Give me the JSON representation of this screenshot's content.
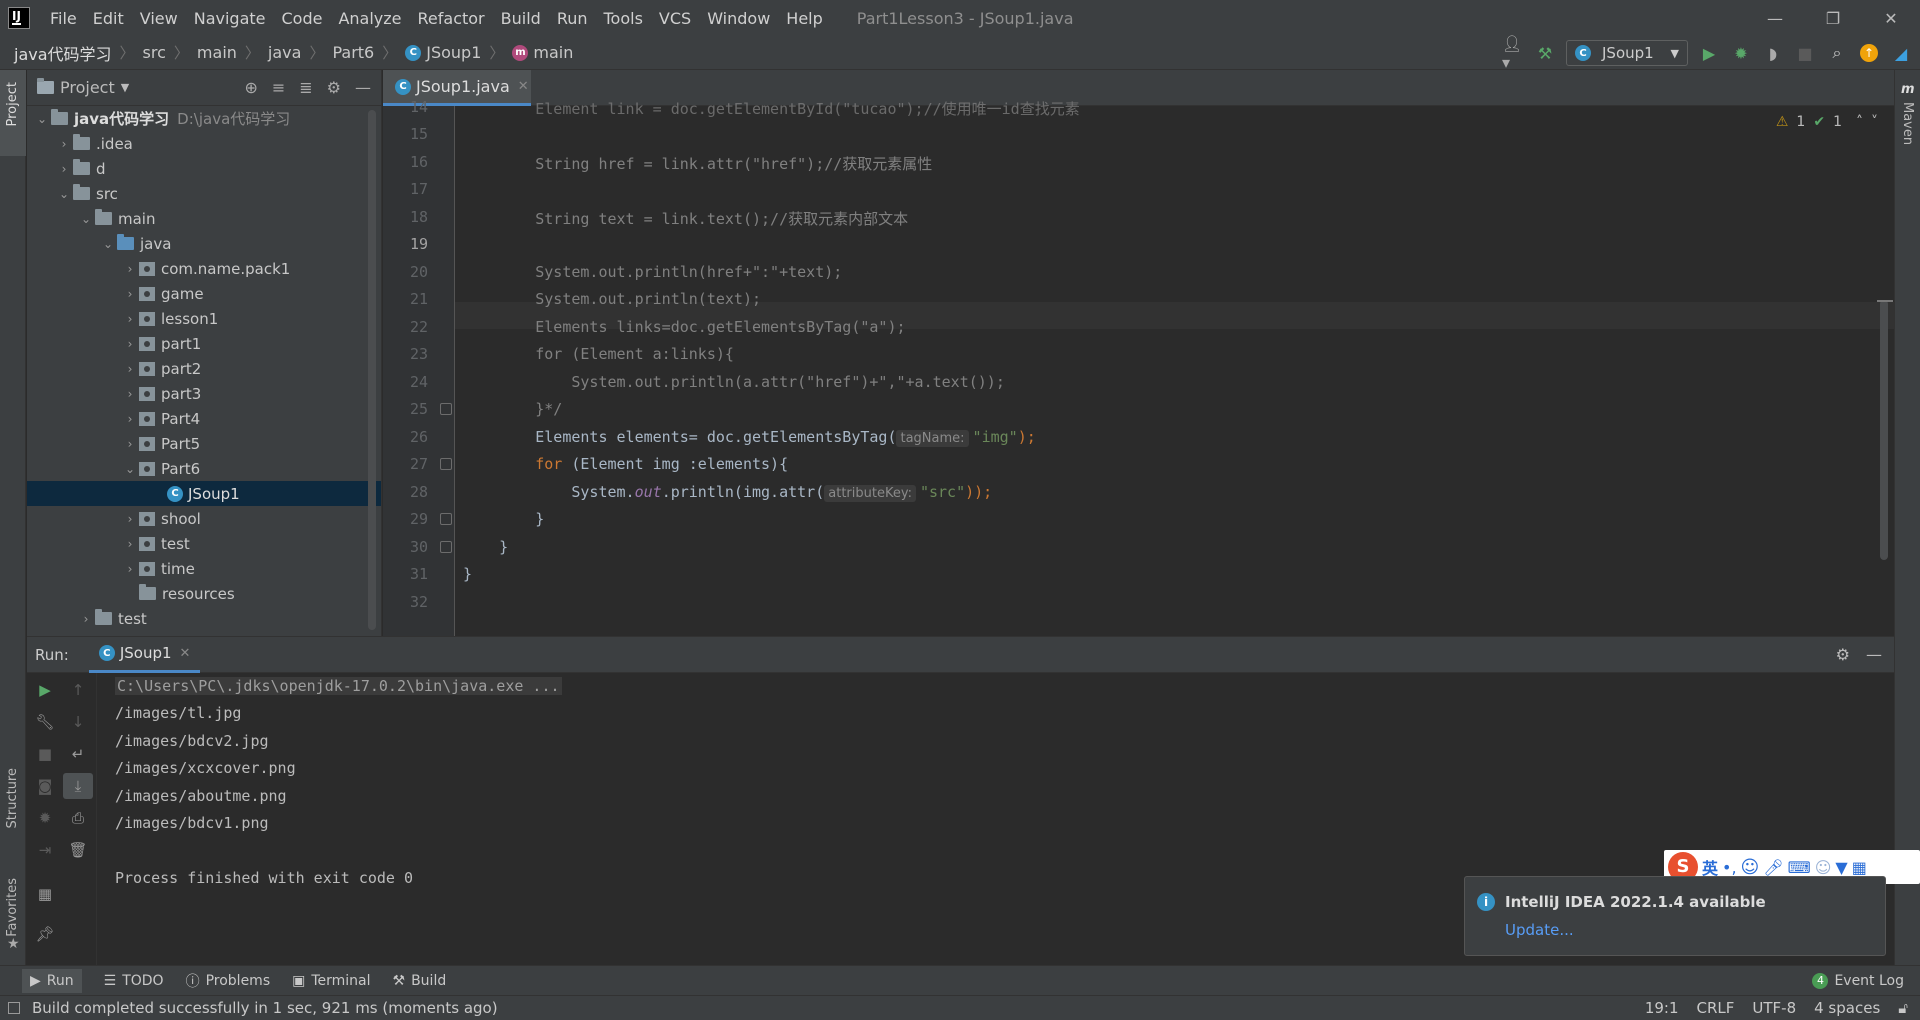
{
  "window": {
    "title": "Part1Lesson3 - JSoup1.java",
    "menu": [
      "File",
      "Edit",
      "View",
      "Navigate",
      "Code",
      "Analyze",
      "Refactor",
      "Build",
      "Run",
      "Tools",
      "VCS",
      "Window",
      "Help"
    ]
  },
  "breadcrumb": {
    "items": [
      "java代码学习",
      "src",
      "main",
      "java",
      "Part6",
      "JSoup1",
      "main"
    ]
  },
  "toolbar": {
    "run_config": "JSoup1"
  },
  "side_tabs": {
    "project": "Project",
    "structure": "Structure",
    "favorites": "Favorites",
    "maven": "Maven"
  },
  "project_panel": {
    "title": "Project",
    "tree": [
      {
        "label": "java代码学习",
        "hint": "D:\\java代码学习",
        "type": "root"
      },
      {
        "label": ".idea"
      },
      {
        "label": "d"
      },
      {
        "label": "src"
      },
      {
        "label": "main"
      },
      {
        "label": "java"
      },
      {
        "label": "com.name.pack1"
      },
      {
        "label": "game"
      },
      {
        "label": "lesson1"
      },
      {
        "label": "part1"
      },
      {
        "label": "part2"
      },
      {
        "label": "part3"
      },
      {
        "label": "Part4"
      },
      {
        "label": "Part5"
      },
      {
        "label": "Part6"
      },
      {
        "label": "JSoup1"
      },
      {
        "label": "shool"
      },
      {
        "label": "test"
      },
      {
        "label": "time"
      },
      {
        "label": "resources"
      },
      {
        "label": "test"
      }
    ]
  },
  "editor": {
    "tab": "JSoup1.java",
    "inspections": {
      "warnings": "1",
      "weak": "1"
    },
    "line_numbers": [
      "14",
      "15",
      "16",
      "17",
      "18",
      "19",
      "20",
      "21",
      "22",
      "23",
      "24",
      "25",
      "26",
      "27",
      "28",
      "29",
      "30",
      "31",
      "32"
    ],
    "lines": {
      "l14": "        Element link = doc.getElementById(\"tucao\");//使用唯一id查找元素",
      "l16": "        String href = link.attr(\"href\");//获取元素属性",
      "l18": "        String text = link.text();//获取元素内部文本",
      "l20": "        System.out.println(href+\":\"+text);",
      "l21": "        System.out.println(text);",
      "l22": "        Elements links=doc.getElementsByTag(\"a\");",
      "l23": "        for (Element a:links){",
      "l24": "            System.out.println(a.attr(\"href\")+\",\"+a.text());",
      "l25": "        }*/",
      "l26a": "        Elements elements= doc.getElementsByTag(",
      "l26hint": "tagName:",
      "l26str": "\"img\"",
      "l26end": ");",
      "l27kw": "        for",
      "l27rest": " (Element img :elements){",
      "l28a": "            System.",
      "l28out": "out",
      "l28b": ".println(img.attr(",
      "l28hint": "attributeKey:",
      "l28str": "\"src\"",
      "l28end": "));",
      "l29": "        }",
      "l30": "    }",
      "l31": "}"
    }
  },
  "run_panel": {
    "label": "Run:",
    "tab": "JSoup1",
    "command": "C:\\Users\\PC\\.jdks\\openjdk-17.0.2\\bin\\java.exe ...",
    "output": [
      "/images/tl.jpg",
      "/images/bdcv2.jpg",
      "/images/xcxcover.png",
      "/images/aboutme.png",
      "/images/bdcv1.png"
    ],
    "exit": "Process finished with exit code 0"
  },
  "notification": {
    "title": "IntelliJ IDEA 2022.1.4 available",
    "link": "Update..."
  },
  "ime": {
    "lang": "英"
  },
  "bottom_tabs": [
    "Run",
    "TODO",
    "Problems",
    "Terminal",
    "Build"
  ],
  "event_log": {
    "count": "4",
    "label": "Event Log"
  },
  "status": {
    "message": "Build completed successfully in 1 sec, 921 ms (moments ago)",
    "position": "19:1",
    "line_sep": "CRLF",
    "encoding": "UTF-8",
    "indent": "4 spaces"
  }
}
